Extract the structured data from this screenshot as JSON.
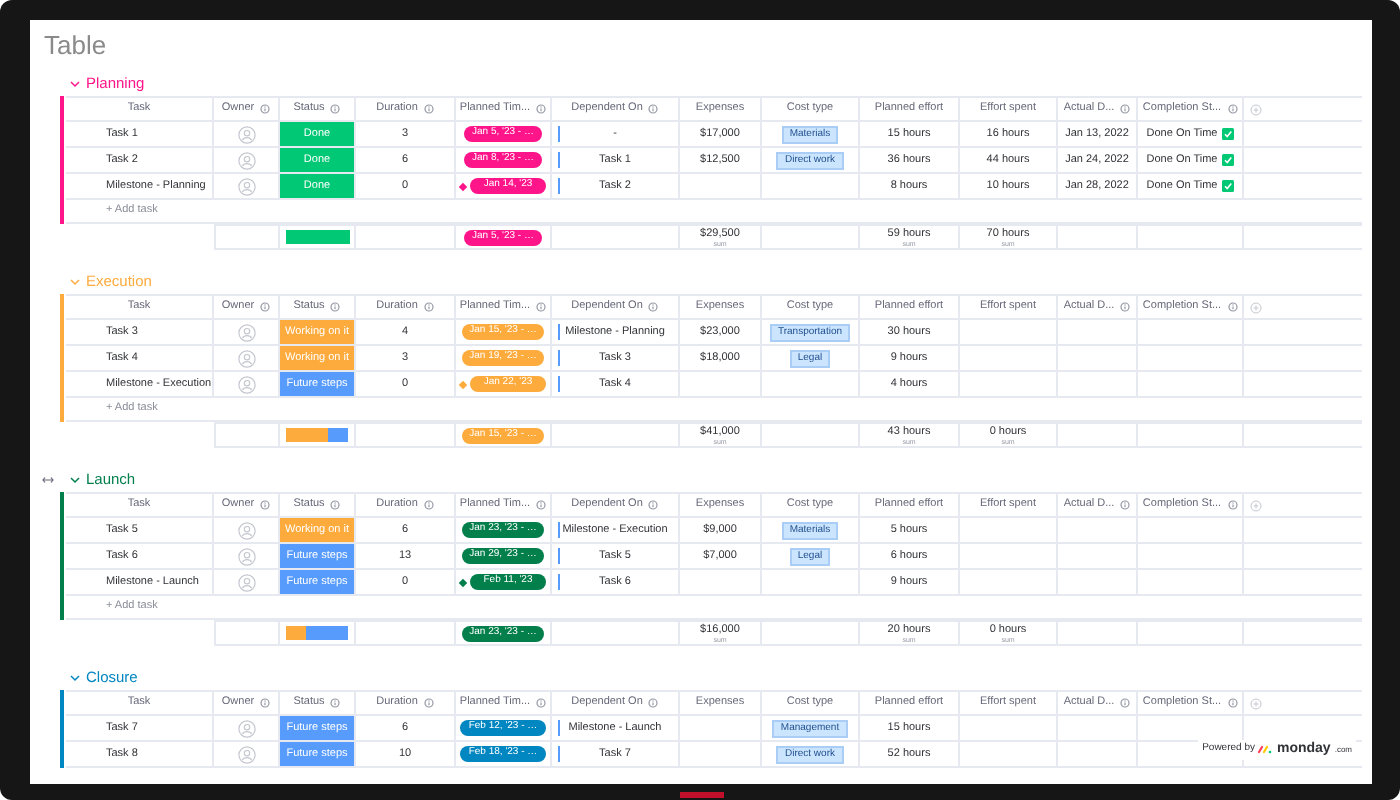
{
  "title": "Table",
  "groups": [
    {
      "name": "Planning",
      "color": "#ff158a",
      "hovered": false,
      "columns": [
        {
          "label": "Task",
          "kind": "plain"
        },
        {
          "label": "Owner",
          "kind": "with_info"
        },
        {
          "label": "Status",
          "kind": "with_info"
        },
        {
          "label": "Duration",
          "kind": "with_info"
        },
        {
          "label": "Planned Tim...",
          "kind": "with_info"
        },
        {
          "label": "Dependent On",
          "kind": "with_info"
        },
        {
          "label": "Expenses",
          "kind": "plain"
        },
        {
          "label": "Cost type",
          "kind": "plain"
        },
        {
          "label": "Planned effort",
          "kind": "plain"
        },
        {
          "label": "Effort spent",
          "kind": "plain"
        },
        {
          "label": "Actual D...",
          "kind": "with_info"
        },
        {
          "label": "Completion St...",
          "kind": "with_info"
        }
      ],
      "rows": [
        {
          "task": "Task 1",
          "kind": "task",
          "status": {
            "label": "Done",
            "color": "#00c875"
          },
          "duration": "3",
          "timeline": "Jan 5, '23 - …",
          "dependent_on": "-",
          "expenses": "$17,000",
          "cost_type": "Materials",
          "planned_effort": "15 hours",
          "effort_spent": "16 hours",
          "actual_date": "Jan 13, 2022",
          "completion": "Done On Time",
          "checked": true
        },
        {
          "task": "Task 2",
          "kind": "task",
          "status": {
            "label": "Done",
            "color": "#00c875"
          },
          "duration": "6",
          "timeline": "Jan 8, '23 - …",
          "dependent_on": "Task 1",
          "expenses": "$12,500",
          "cost_type": "Direct work",
          "planned_effort": "36 hours",
          "effort_spent": "44 hours",
          "actual_date": "Jan 24, 2022",
          "completion": "Done On Time",
          "checked": true
        },
        {
          "task": "Milestone - Planning",
          "kind": "milestone",
          "status": {
            "label": "Done",
            "color": "#00c875"
          },
          "duration": "0",
          "timeline": "Jan 14, '23",
          "dependent_on": "Task 2",
          "planned_effort": "8 hours",
          "effort_spent": "10 hours",
          "actual_date": "Jan 28, 2022",
          "completion": "Done On Time",
          "checked": true
        }
      ],
      "add_task": "+ Add task",
      "summary": {
        "segments": [
          {
            "color": "#00c875",
            "level": 1
          }
        ],
        "timeline": "Jan 5, '23 - …",
        "expenses": "$29,500",
        "expenses_note": "sum",
        "planned_effort": "59 hours",
        "planned_note": "sum",
        "effort_spent": "70 hours",
        "effort_note": "sum"
      }
    },
    {
      "name": "Execution",
      "color": "#fdab3d",
      "hovered": false,
      "columns": [
        {
          "label": "Task",
          "kind": "plain"
        },
        {
          "label": "Owner",
          "kind": "with_info"
        },
        {
          "label": "Status",
          "kind": "with_info"
        },
        {
          "label": "Duration",
          "kind": "with_info"
        },
        {
          "label": "Planned Tim...",
          "kind": "with_info"
        },
        {
          "label": "Dependent On",
          "kind": "with_info"
        },
        {
          "label": "Expenses",
          "kind": "plain"
        },
        {
          "label": "Cost type",
          "kind": "plain"
        },
        {
          "label": "Planned effort",
          "kind": "plain"
        },
        {
          "label": "Effort spent",
          "kind": "plain"
        },
        {
          "label": "Actual D...",
          "kind": "with_info"
        },
        {
          "label": "Completion St...",
          "kind": "with_info"
        }
      ],
      "rows": [
        {
          "task": "Task 3",
          "kind": "task",
          "status": {
            "label": "Working on it",
            "color": "#fdab3d"
          },
          "duration": "4",
          "timeline": "Jan 15, '23 - …",
          "dependent_on": "Milestone - Planning",
          "expenses": "$23,000",
          "cost_type": "Transportation",
          "planned_effort": "30 hours",
          "checked": false
        },
        {
          "task": "Task 4",
          "kind": "task",
          "status": {
            "label": "Working on it",
            "color": "#fdab3d"
          },
          "duration": "3",
          "timeline": "Jan 19, '23 - …",
          "dependent_on": "Task 3",
          "expenses": "$18,000",
          "cost_type": "Legal",
          "planned_effort": "9 hours",
          "checked": false
        },
        {
          "task": "Milestone - Execution",
          "kind": "milestone",
          "status": {
            "label": "Future steps",
            "color": "#579bfc"
          },
          "duration": "0",
          "timeline": "Jan 22, '23",
          "dependent_on": "Task 4",
          "planned_effort": "4 hours",
          "checked": false
        }
      ],
      "add_task": "+ Add task",
      "summary": {
        "segments": [
          {
            "color": "#fdab3d",
            "level": 0.67
          },
          {
            "color": "#579bfc",
            "level": 0.33
          }
        ],
        "timeline": "Jan 15, '23 - …",
        "expenses": "$41,000",
        "expenses_note": "sum",
        "planned_effort": "43 hours",
        "planned_note": "sum",
        "effort_spent": "0 hours",
        "effort_note": "sum"
      }
    },
    {
      "name": "Launch",
      "color": "#037f4c",
      "hovered": true,
      "columns": [
        {
          "label": "Task",
          "kind": "plain"
        },
        {
          "label": "Owner",
          "kind": "with_info"
        },
        {
          "label": "Status",
          "kind": "with_info"
        },
        {
          "label": "Duration",
          "kind": "with_info"
        },
        {
          "label": "Planned Tim...",
          "kind": "with_info"
        },
        {
          "label": "Dependent On",
          "kind": "with_info"
        },
        {
          "label": "Expenses",
          "kind": "plain"
        },
        {
          "label": "Cost type",
          "kind": "plain"
        },
        {
          "label": "Planned effort",
          "kind": "plain"
        },
        {
          "label": "Effort spent",
          "kind": "plain"
        },
        {
          "label": "Actual D...",
          "kind": "with_info"
        },
        {
          "label": "Completion St...",
          "kind": "with_info"
        }
      ],
      "rows": [
        {
          "task": "Task 5",
          "kind": "task",
          "status": {
            "label": "Working on it",
            "color": "#fdab3d"
          },
          "duration": "6",
          "timeline": "Jan 23, '23 - …",
          "dependent_on": "Milestone - Execution",
          "expenses": "$9,000",
          "cost_type": "Materials",
          "planned_effort": "5 hours",
          "checked": false
        },
        {
          "task": "Task 6",
          "kind": "task",
          "status": {
            "label": "Future steps",
            "color": "#579bfc"
          },
          "duration": "13",
          "timeline": "Jan 29, '23 - …",
          "dependent_on": "Task 5",
          "expenses": "$7,000",
          "cost_type": "Legal",
          "planned_effort": "6 hours",
          "checked": false
        },
        {
          "task": "Milestone - Launch",
          "kind": "milestone",
          "status": {
            "label": "Future steps",
            "color": "#579bfc"
          },
          "duration": "0",
          "timeline": "Feb 11, '23",
          "dependent_on": "Task 6",
          "planned_effort": "9 hours",
          "checked": false
        }
      ],
      "add_task": "+ Add task",
      "summary": {
        "segments": [
          {
            "color": "#fdab3d",
            "level": 0.33
          },
          {
            "color": "#579bfc",
            "level": 0.67
          }
        ],
        "timeline": "Jan 23, '23 - …",
        "expenses": "$16,000",
        "expenses_note": "sum",
        "planned_effort": "20 hours",
        "planned_note": "sum",
        "effort_spent": "0 hours",
        "effort_note": "sum"
      }
    },
    {
      "name": "Closure",
      "color": "#0086c0",
      "hovered": false,
      "columns": [
        {
          "label": "Task",
          "kind": "plain"
        },
        {
          "label": "Owner",
          "kind": "with_info"
        },
        {
          "label": "Status",
          "kind": "with_info"
        },
        {
          "label": "Duration",
          "kind": "with_info"
        },
        {
          "label": "Planned Tim...",
          "kind": "with_info"
        },
        {
          "label": "Dependent On",
          "kind": "with_info"
        },
        {
          "label": "Expenses",
          "kind": "plain"
        },
        {
          "label": "Cost type",
          "kind": "plain"
        },
        {
          "label": "Planned effort",
          "kind": "plain"
        },
        {
          "label": "Effort spent",
          "kind": "plain"
        },
        {
          "label": "Actual D...",
          "kind": "with_info"
        },
        {
          "label": "Completion St...",
          "kind": "with_info"
        }
      ],
      "rows": [
        {
          "task": "Task 7",
          "kind": "task",
          "status": {
            "label": "Future steps",
            "color": "#579bfc"
          },
          "duration": "6",
          "timeline": "Feb 12, '23 - …",
          "dependent_on": "Milestone - Launch",
          "cost_type": "Management",
          "planned_effort": "15 hours",
          "checked": false
        },
        {
          "task": "Task 8",
          "kind": "task",
          "status": {
            "label": "Future steps",
            "color": "#579bfc"
          },
          "duration": "10",
          "timeline": "Feb 18, '23 - …",
          "dependent_on": "Task 7",
          "cost_type": "Direct work",
          "planned_effort": "52 hours",
          "checked": false
        }
      ]
    }
  ],
  "footer": {
    "text": "Powered by",
    "brand": "monday",
    "suffix": ".com"
  }
}
